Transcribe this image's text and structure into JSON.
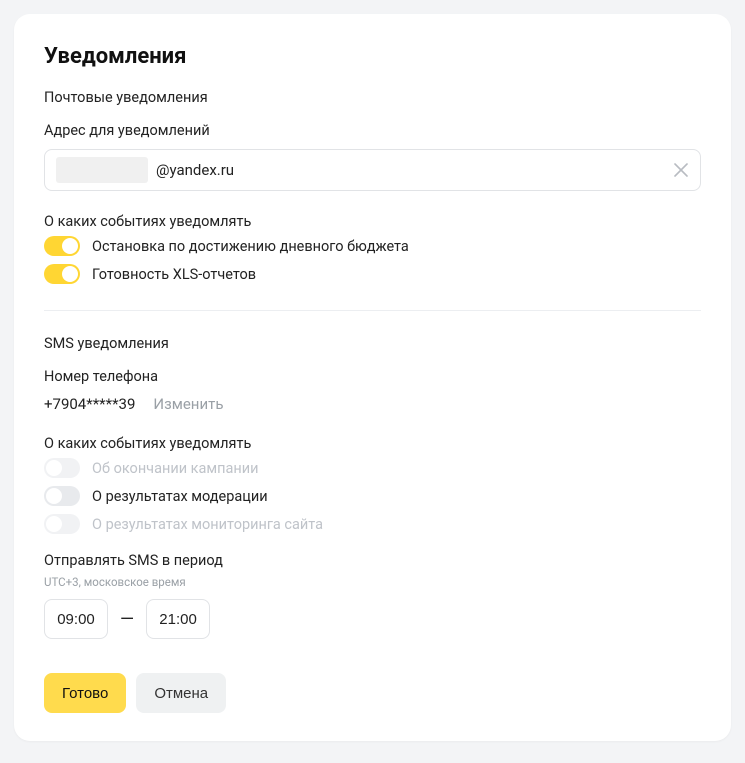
{
  "title": "Уведомления",
  "email": {
    "section_label": "Почтовые уведомления",
    "field_label": "Адрес для уведомлений",
    "visible_suffix": "@yandex.ru",
    "events_label": "О каких событиях уведомлять",
    "toggles": [
      {
        "label": "Остановка по достижению дневного бюджета",
        "on": true,
        "disabled": false
      },
      {
        "label": "Готовность XLS-отчетов",
        "on": true,
        "disabled": false
      }
    ]
  },
  "sms": {
    "section_label": "SMS уведомления",
    "phone_label": "Номер телефона",
    "phone_value": "+7904*****39",
    "change_label": "Изменить",
    "events_label": "О каких событиях уведомлять",
    "toggles": [
      {
        "label": "Об окончании кампании",
        "on": false,
        "disabled": true
      },
      {
        "label": "О результатах модерации",
        "on": false,
        "disabled": false
      },
      {
        "label": "О результатах мониторинга сайта",
        "on": false,
        "disabled": true
      }
    ],
    "period_label": "Отправлять SMS в период",
    "tz_note": "UTC+3, московское время",
    "time_from": "09:00",
    "time_to": "21:00"
  },
  "footer": {
    "done_label": "Готово",
    "cancel_label": "Отмена"
  }
}
